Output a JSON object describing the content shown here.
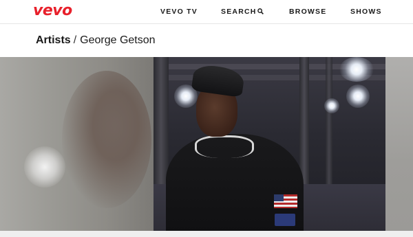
{
  "brand": {
    "logo_text": "vevo",
    "color": "#e8202b"
  },
  "nav": {
    "items": [
      {
        "label": "VEVO TV"
      },
      {
        "label": "SEARCH",
        "icon": "search-icon"
      },
      {
        "label": "BROWSE"
      },
      {
        "label": "SHOWS"
      }
    ]
  },
  "breadcrumb": {
    "parent": "Artists",
    "separator": "/",
    "current": "George Getson"
  }
}
